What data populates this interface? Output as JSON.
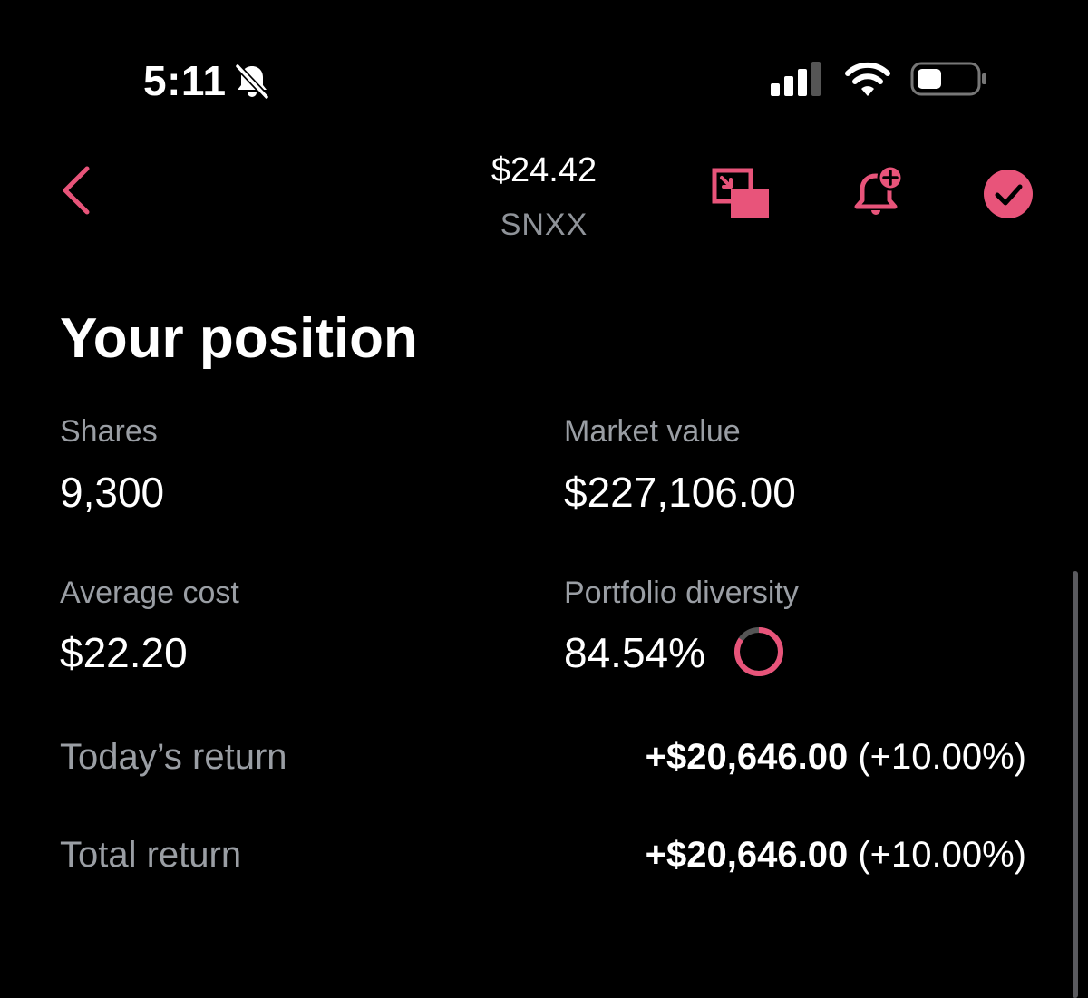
{
  "status_bar": {
    "time": "5:11",
    "icons": [
      "bell-slash-icon",
      "signal-icon",
      "wifi-icon",
      "battery-icon"
    ]
  },
  "header": {
    "price": "$24.42",
    "symbol": "SNXX",
    "icons": [
      "back-icon",
      "pip-icon",
      "alert-add-icon",
      "check-icon"
    ]
  },
  "position": {
    "title": "Your position",
    "shares_label": "Shares",
    "shares_value": "9,300",
    "market_value_label": "Market value",
    "market_value_value": "$227,106.00",
    "avg_cost_label": "Average cost",
    "avg_cost_value": "$22.20",
    "diversity_label": "Portfolio diversity",
    "diversity_value": "84.54%",
    "diversity_fraction": 0.8454,
    "todays_return_label": "Today’s return",
    "todays_return_amount": "+$20,646.00",
    "todays_return_percent": "(+10.00%)",
    "total_return_label": "Total return",
    "total_return_amount": "+$20,646.00",
    "total_return_percent": "(+10.00%)"
  },
  "colors": {
    "accent": "#e8547a",
    "background": "#000000",
    "muted_text": "#9a9ea4",
    "ring_track": "#555555"
  }
}
